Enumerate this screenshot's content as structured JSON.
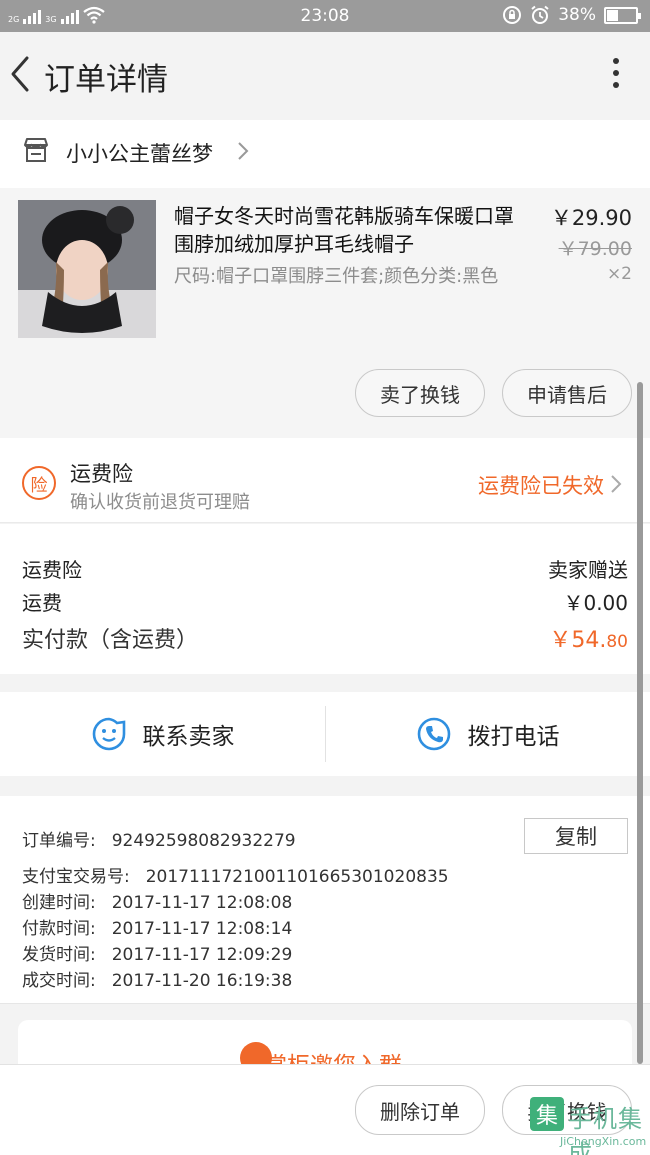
{
  "status_bar": {
    "sig1": "2G",
    "sig2": "3G",
    "time": "23:08",
    "battery": "38%",
    "battery_level": 0.38
  },
  "header": {
    "title": "订单详情"
  },
  "shop": {
    "name": "小小公主蕾丝梦"
  },
  "product": {
    "title": "帽子女冬天时尚雪花韩版骑车保暖口罩围脖加绒加厚护耳毛线帽子",
    "spec": "尺码:帽子口罩围脖三件套;颜色分类:黑色",
    "price": "￥29.90",
    "original_price": "￥79.00",
    "quantity": "×2",
    "btn_sell": "卖了换钱",
    "btn_after_sale": "申请售后"
  },
  "insurance": {
    "icon_text": "险",
    "title": "运费险",
    "subtitle": "确认收货前退货可理赔",
    "status": "运费险已失效"
  },
  "fees": {
    "insurance_label": "运费险",
    "insurance_value": "卖家赠送",
    "shipping_label": "运费",
    "shipping_value": "￥0.00",
    "paid_label": "实付款（含运费）",
    "paid_main": "￥54.",
    "paid_cents": "80"
  },
  "contact": {
    "seller_label": "联系卖家",
    "call_label": "拨打电话"
  },
  "order": {
    "order_no_label": "订单编号:",
    "order_no": "92492598082932279",
    "copy_label": "复制",
    "alipay_label": "支付宝交易号:",
    "alipay_no": "2017111721001101665301020835",
    "created_label": "创建时间:",
    "created": "2017-11-17 12:08:08",
    "paid_label": "付款时间:",
    "paid": "2017-11-17 12:08:14",
    "shipped_label": "发货时间:",
    "shipped": "2017-11-17 12:09:29",
    "completed_label": "成交时间:",
    "completed": "2017-11-20 16:19:38"
  },
  "invite": {
    "text": "掌柜邀您入群"
  },
  "bottom": {
    "delete_label": "删除订单",
    "sell_label": "卖了换钱"
  },
  "watermark": {
    "cn": "手机集成",
    "en": "JiChengXin.com",
    "logo": "集"
  },
  "colors": {
    "accent": "#f0682a",
    "blue_icon": "#2f8fe0"
  }
}
